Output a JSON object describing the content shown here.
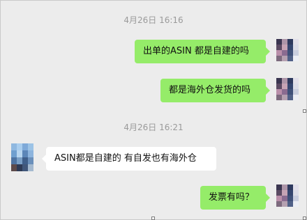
{
  "chat": {
    "timestamps": [
      "4月26日 16:16",
      "4月26日 16:21"
    ],
    "messages": [
      {
        "direction": "out",
        "text": "出单的ASIN 都是自建的吗"
      },
      {
        "direction": "out",
        "text": "都是海外仓发货的吗"
      },
      {
        "direction": "in",
        "text": "ASIN都是自建的 有自发也有海外仓"
      },
      {
        "direction": "out",
        "text": "发票有吗？"
      }
    ]
  },
  "colors": {
    "background": "#ececec",
    "outgoing_bubble": "#95ec69",
    "incoming_bubble": "#ffffff",
    "timestamp_text": "#9a9a9a"
  },
  "icons": {
    "self_avatar": "pixelated-avatar",
    "contact_avatar": "pixelated-avatar"
  }
}
